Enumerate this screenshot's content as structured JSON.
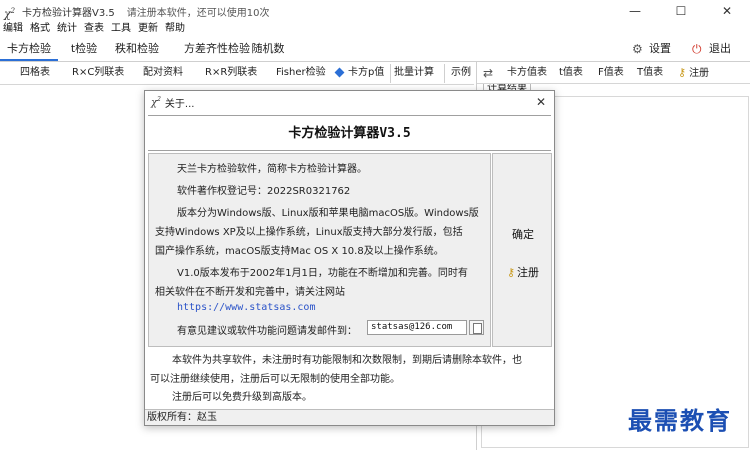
{
  "window": {
    "title": "卡方检验计算器V3.5",
    "note": "请注册本软件，还可以使用10次",
    "min_glyph": "—",
    "max_glyph": "☐",
    "close_glyph": "✕"
  },
  "menu": [
    "编辑",
    "格式",
    "统计",
    "查表",
    "工具",
    "更新",
    "帮助"
  ],
  "main_tabs": [
    {
      "label": "卡方检验",
      "active": true
    },
    {
      "label": "t检验",
      "active": false
    },
    {
      "label": "秩和检验",
      "active": false
    },
    {
      "label": "方差齐性检验",
      "active": false
    },
    {
      "label": "随机数",
      "active": false
    }
  ],
  "top_actions": {
    "settings": "设置",
    "exit": "退出"
  },
  "sub_tabs": [
    {
      "label": "四格表"
    },
    {
      "label": "R×C列联表"
    },
    {
      "label": "配对资料"
    },
    {
      "label": "R×R列联表"
    },
    {
      "label": "Fisher检验"
    },
    {
      "label": "卡方p值",
      "active": true
    },
    {
      "label": "批量计算"
    },
    {
      "label": "示例"
    }
  ],
  "right_tabs": [
    "卡方值表",
    "t值表",
    "F值表",
    "T值表"
  ],
  "right_register": "注册",
  "right_result_tab": "计算结果",
  "dialog": {
    "title": "关于...",
    "close_glyph": "✕",
    "header": "卡方检验计算器V3.5",
    "info_lines": [
      "天兰卡方检验软件，简称卡方检验计算器。",
      "软件著作权登记号：2022SR0321762",
      "版本分为Windows版、Linux版和苹果电脑macOS版。Windows版",
      "支持Windows XP及以上操作系统，Linux版支持大部分发行版，包括",
      "国产操作系统，macOS版支持Mac OS X 10.8及以上操作系统。",
      "V1.0版本发布于2002年1月1日，功能在不断增加和完善。同时有",
      "相关软件在不断开发和完善中，请关注网站"
    ],
    "website": "https://www.statsas.com",
    "email_label": "有意见建议或软件功能问题请发邮件到：",
    "email": "statsas@126.com",
    "ok_button": "确定",
    "register_button": "注册",
    "notice_lines": [
      "本软件为共享软件，未注册时有功能限制和次数限制，到期后请删除本软件，也",
      "可以注册继续使用，注册后可以无限制的使用全部功能。",
      "注册后可以免费升级到高版本。"
    ],
    "footer": "版权所有：赵玉"
  },
  "watermark": "最需教育",
  "colors": {
    "accent": "#2b6fd6",
    "link": "#2b53c8",
    "watermark": "#1c4fb3",
    "exit_icon": "#d23b2e"
  }
}
